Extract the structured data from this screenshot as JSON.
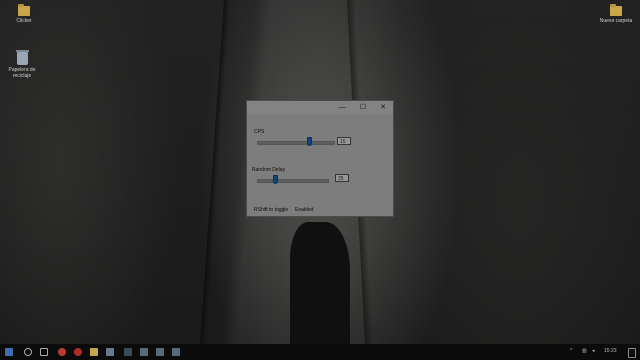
{
  "desktop": {
    "icons": [
      {
        "label": "Clicker"
      },
      {
        "label": "Papelera de reciclaje"
      },
      {
        "label": "Nueva carpeta"
      }
    ]
  },
  "window": {
    "controls": {
      "minimize": "—",
      "maximize": "☐",
      "close": "✕"
    },
    "cps": {
      "label": "CPS",
      "value": "15"
    },
    "random_delay": {
      "label": "Random Delay",
      "value": "25"
    },
    "status": {
      "hotkey": "RShift to toggle",
      "state": "Enabled"
    }
  },
  "taskbar": {
    "clock": "15:23",
    "icons": [
      "start-icon",
      "search-icon",
      "task-view-icon",
      "chrome-icon",
      "opera-icon",
      "file-explorer-icon",
      "store-icon",
      "steam-icon",
      "app-icon",
      "app-icon",
      "app-icon"
    ]
  },
  "colors": {
    "accent": "#1e6fc8"
  }
}
